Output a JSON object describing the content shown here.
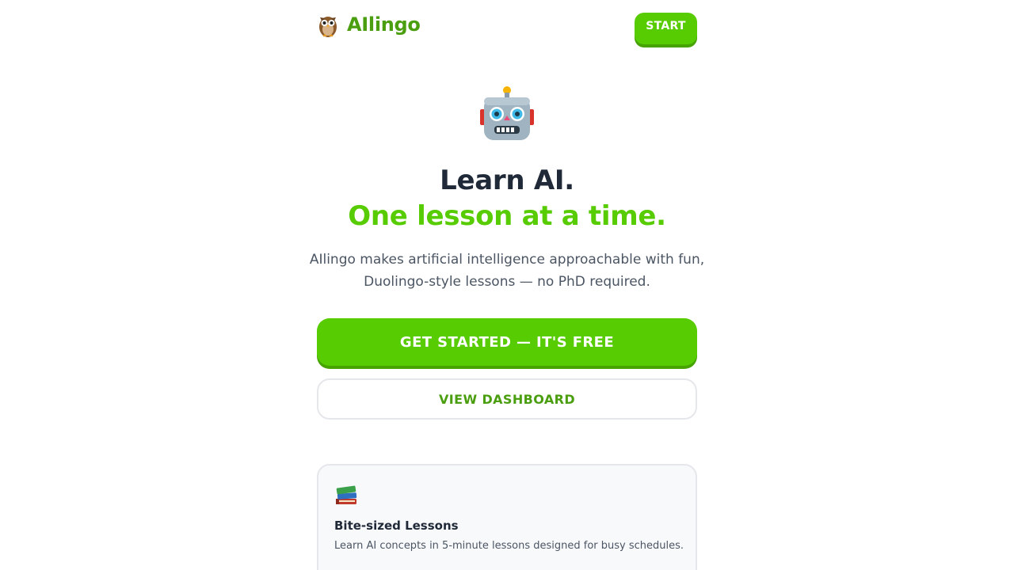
{
  "header": {
    "brand_icon": "owl-icon",
    "brand_name": "AIlingo",
    "start_label": "START"
  },
  "hero": {
    "icon": "robot-icon",
    "headline": "Learn AI.",
    "headline_accent": "One lesson at a time.",
    "subtitle_line1": "AIlingo makes artificial intelligence approachable with fun,",
    "subtitle_line2": "Duolingo-style lessons — no PhD required.",
    "cta_primary": "GET STARTED — IT'S FREE",
    "cta_secondary": "VIEW DASHBOARD"
  },
  "features": [
    {
      "icon": "books-icon",
      "title": "Bite-sized Lessons",
      "description": "Learn AI concepts in 5-minute lessons designed for busy schedules."
    }
  ],
  "colors": {
    "brand_green": "#58cc02",
    "brand_green_dark": "#46a302",
    "brand_text_green": "#4a9e0f",
    "heading": "#1f2937",
    "body_text": "#4b5563",
    "border": "#e5e7eb"
  }
}
